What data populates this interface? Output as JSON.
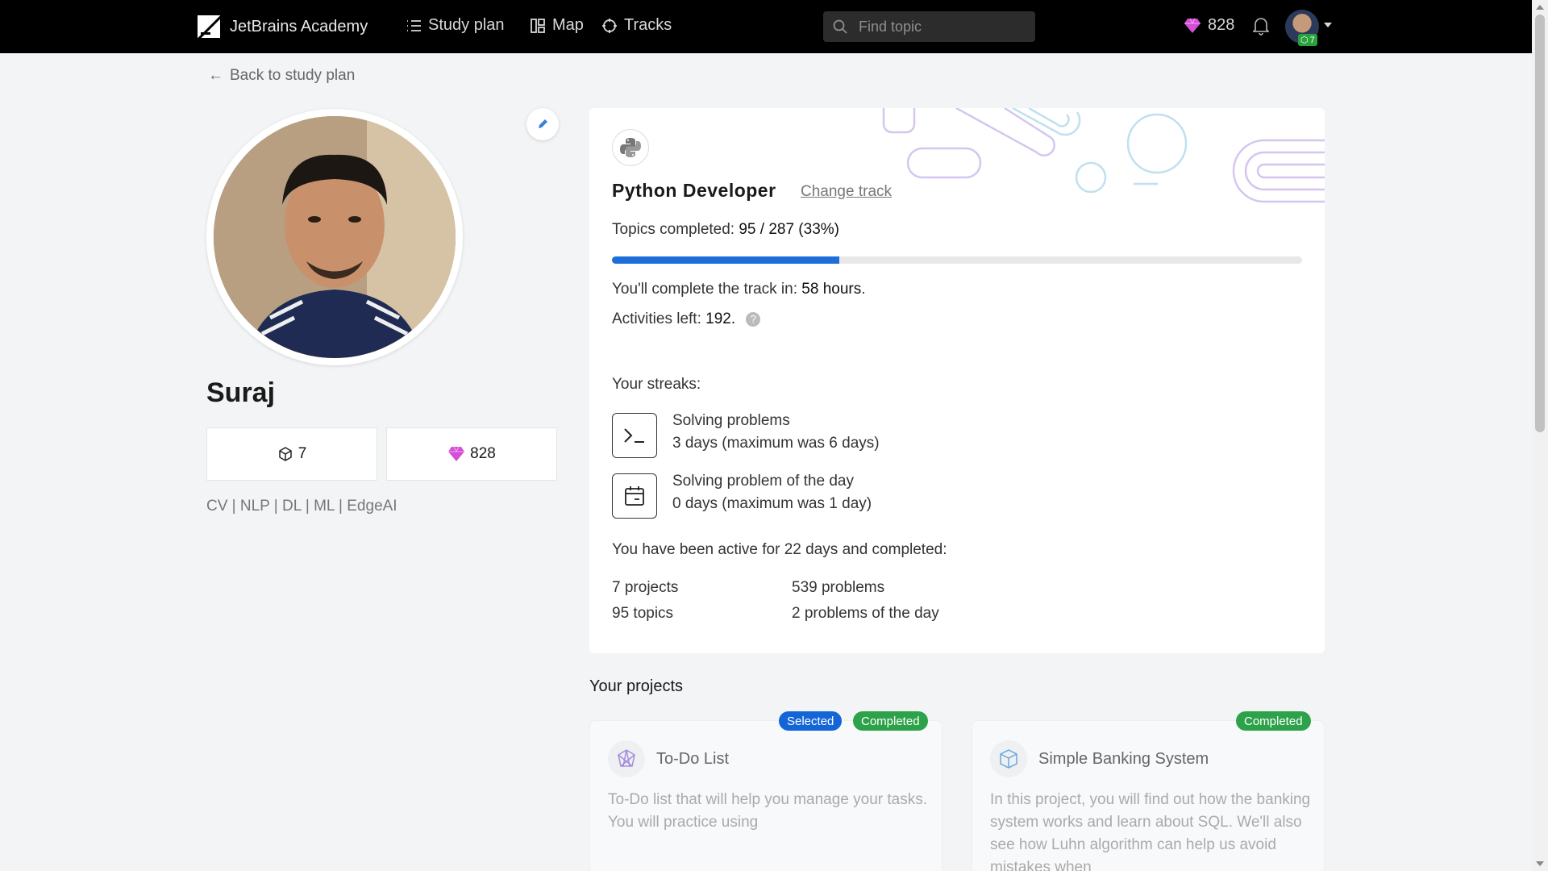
{
  "nav": {
    "brand": "JetBrains Academy",
    "study_plan": "Study plan",
    "map": "Map",
    "tracks": "Tracks",
    "search_placeholder": "Find topic",
    "gems": "828",
    "badge_count": "7"
  },
  "back_link": "Back to study plan",
  "profile": {
    "name": "Suraj",
    "projects_count": "7",
    "gems": "828",
    "bio": "CV | NLP | DL | ML | EdgeAI"
  },
  "track": {
    "title": "Python Developer",
    "change_track": "Change track",
    "topics_label": "Topics completed:",
    "topics_value": "95 / 287 (33%)",
    "progress_fraction": 0.33,
    "complete_label": "You'll complete the track in:",
    "complete_value": "58 hours",
    "activities_label": "Activities left:",
    "activities_value": "192.",
    "streaks_title": "Your streaks:",
    "streak1_title": "Solving problems",
    "streak1_days": "3",
    "streak1_mid": "days (maximum was",
    "streak1_max": "6",
    "streak1_end": "days)",
    "streak2_title": "Solving problem of the day",
    "streak2_days": "0",
    "streak2_mid": "days (maximum was",
    "streak2_max": "1",
    "streak2_end": "day)",
    "active_pre": "You have been active for",
    "active_days": "22",
    "active_post": "days and completed:",
    "projects_num": "7",
    "projects_word": "projects",
    "problems_num": "539",
    "problems_word": "problems",
    "topics_num": "95",
    "topics_word": "topics",
    "potd_num": "2",
    "potd_word": "problems of the day"
  },
  "projects": {
    "title": "Your projects",
    "items": [
      {
        "name": "To-Do List",
        "description": "To-Do list that will help you manage your tasks. You will practice using",
        "badges": [
          "Selected",
          "Completed"
        ]
      },
      {
        "name": "Simple Banking System",
        "description": "In this project, you will find out how the banking system works and learn about SQL. We'll also see how Luhn algorithm can help us avoid mistakes when",
        "badges": [
          "Completed"
        ]
      }
    ]
  },
  "colors": {
    "accent": "#1d6ed8",
    "completed": "#2ea24a",
    "gem": "#d24fd6"
  }
}
